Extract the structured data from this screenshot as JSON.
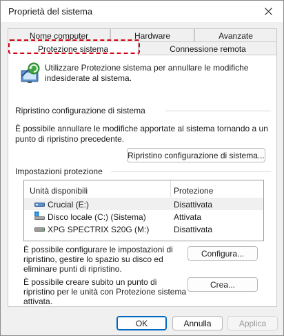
{
  "window": {
    "title": "Proprietà del sistema"
  },
  "tabs": {
    "row1": [
      "Nome computer",
      "Hardware",
      "Avanzate"
    ],
    "row2": [
      "Protezione sistema",
      "Connessione remota"
    ],
    "active": "Protezione sistema"
  },
  "intro": "Utilizzare Protezione sistema per annullare le modifiche indesiderate al sistema.",
  "restore_section": {
    "title": "Ripristino configurazione di sistema",
    "description": "È possibile annullare le modifiche apportate al sistema tornando a un punto di ripristino precedente.",
    "button": "Ripristino configurazione di sistema..."
  },
  "protection_section": {
    "title": "Impostazioni protezione",
    "columns": [
      "Unità disponibili",
      "Protezione"
    ],
    "drives": [
      {
        "name": "Crucial (E:)",
        "status": "Disattivata",
        "icon": "usb-drive-icon",
        "selected": true
      },
      {
        "name": "Disco locale (C:) (Sistema)",
        "status": "Attivata",
        "icon": "system-drive-icon",
        "selected": false
      },
      {
        "name": "XPG SPECTRIX S20G (M:)",
        "status": "Disattivata",
        "icon": "hard-drive-icon",
        "selected": false
      }
    ],
    "configure_text": "È possibile configurare le impostazioni di ripristino, gestire lo spazio su disco ed eliminare punti di ripristino.",
    "configure_button": "Configura...",
    "create_text": "È possibile creare subito un punto di ripristino per le unità con Protezione sistema attivata.",
    "create_button": "Crea..."
  },
  "footer": {
    "ok": "OK",
    "cancel": "Annulla",
    "apply": "Applica"
  },
  "colors": {
    "accent": "#0067c0",
    "focus_highlight": "#d4000e"
  }
}
